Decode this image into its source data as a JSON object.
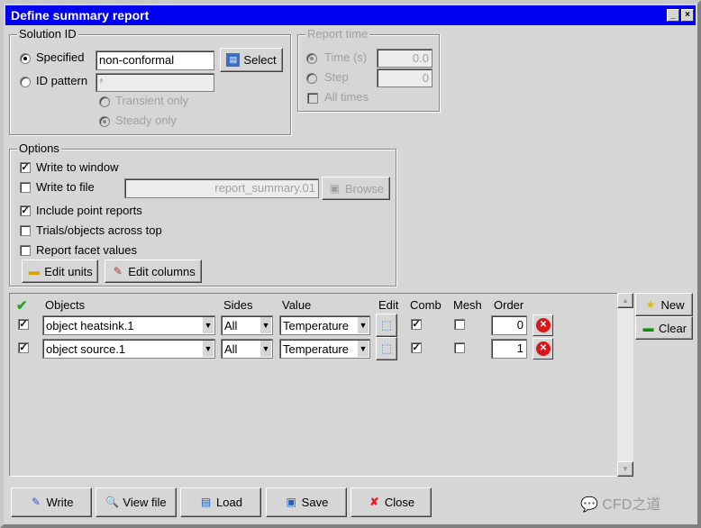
{
  "window": {
    "title": "Define summary report"
  },
  "solution_id": {
    "label": "Solution ID",
    "specified_label": "Specified",
    "specified_value": "non-conformal",
    "select_label": "Select",
    "id_pattern_label": "ID pattern",
    "id_pattern_value": "*",
    "transient_label": "Transient only",
    "steady_label": "Steady only"
  },
  "report_time": {
    "label": "Report time",
    "time_label": "Time (s)",
    "time_value": "0.0",
    "step_label": "Step",
    "step_value": "0",
    "all_times_label": "All times"
  },
  "options": {
    "label": "Options",
    "write_window": "Write to window",
    "write_file": "Write to file",
    "file_value": "report_summary.01",
    "browse_label": "Browse",
    "point_reports": "Include point reports",
    "trials_top": "Trials/objects across top",
    "facet_values": "Report facet values",
    "edit_units": "Edit units",
    "edit_columns": "Edit columns"
  },
  "table": {
    "headers": {
      "objects": "Objects",
      "sides": "Sides",
      "value": "Value",
      "edit": "Edit",
      "comb": "Comb",
      "mesh": "Mesh",
      "order": "Order"
    },
    "rows": [
      {
        "object": "object heatsink.1",
        "sides": "All",
        "value": "Temperature",
        "order": "0"
      },
      {
        "object": "object source.1",
        "sides": "All",
        "value": "Temperature",
        "order": "1"
      }
    ]
  },
  "side": {
    "new_label": "New",
    "clear_label": "Clear"
  },
  "footer": {
    "write": "Write",
    "view_file": "View file",
    "load": "Load",
    "save": "Save",
    "close": "Close"
  },
  "watermark": "CFD之道"
}
